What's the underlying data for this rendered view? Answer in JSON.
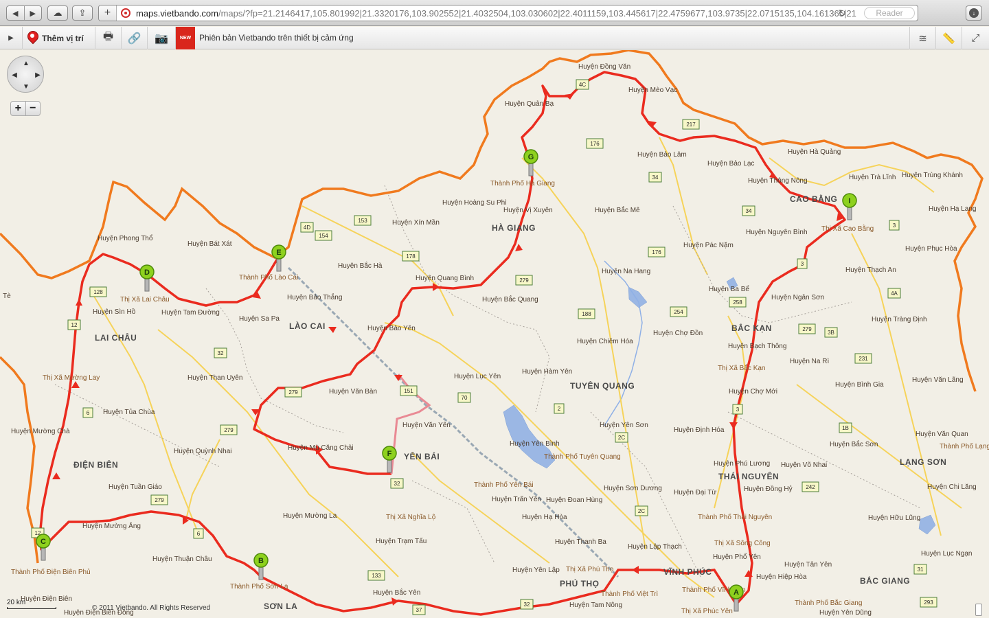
{
  "browser": {
    "url_host": "maps.vietbando.com",
    "url_path": "/maps/?fp=21.2146417,105.801992|21.3320176,103.902552|21.4032504,103.030602|22.4011159,103.445617|22.4759677,103.9735|22.0715135,104.161365|21",
    "reader_label": "Reader",
    "icons": {
      "back": "back-arrow-icon",
      "forward": "forward-arrow-icon",
      "cloud": "icloud-tabs-icon",
      "share": "share-icon",
      "add": "add-bookmark-icon",
      "reload": "reload-icon",
      "download": "download-icon"
    }
  },
  "toolbar": {
    "add_location_label": "Thêm vị trí",
    "new_badge": "NEW",
    "promo_text": "Phiên bản Vietbando trên thiết bị cảm ứng",
    "icons": [
      "print-icon",
      "link-icon",
      "camera-icon",
      "layers-icon",
      "ruler-icon",
      "fullscreen-icon"
    ]
  },
  "map": {
    "colors": {
      "land": "#f2efe6",
      "border": "#f07a1e",
      "route": "#ea2b1f",
      "route_light": "#e98a94",
      "highway": "#f6d35a",
      "water": "#9bb7e4",
      "marker": "#8ed11e"
    },
    "provinces": [
      "CAO BẰNG",
      "HÀ GIANG",
      "LÀO CAI",
      "BẮC KẠN",
      "LAI CHÂU",
      "TUYÊN QUANG",
      "YÊN BÁI",
      "LẠNG SƠN",
      "ĐIỆN BIÊN",
      "THÁI NGUYÊN",
      "VĨNH PHÚC",
      "PHÚ THỌ",
      "BẮC GIANG",
      "SƠN LA"
    ],
    "districts": [
      "Huyện Đồng Văn",
      "Huyện Mèo Vạc",
      "Huyện Quản Bạ",
      "Huyện Bảo Lâm",
      "Huyện Bảo Lạc",
      "Huyện Hà Quảng",
      "Huyện Trà Lĩnh",
      "Huyện Trùng Khánh",
      "Thành Phố Hà Giang",
      "Huyện Hoàng Su Phì",
      "Huyện Vị Xuyên",
      "Huyện Bắc Mê",
      "Huyện Thông Nông",
      "Huyện Hạ Lang",
      "Huyện Xín Mần",
      "Huyện Nguyên Bình",
      "Thị Xã Cao Bằng",
      "Huyện Phong Thổ",
      "Huyện Bát Xát",
      "Huyện Pác Nặm",
      "Huyện Phục Hòa",
      "Huyện Bắc Hà",
      "Thành Phố Lào Cai",
      "Huyện Na Hang",
      "Huyện Thạch An",
      "Thị Xã Lai Châu",
      "Huyện Quang Bình",
      "Huyện Bảo Thắng",
      "Huyện Bắc Quang",
      "Huyện Ba Bể",
      "Huyện Ngân Sơn",
      "Huyện Sìn Hồ",
      "Huyện Tam Đường",
      "Huyện Sa Pa",
      "Huyện Tràng Định",
      "Huyện Bảo Yên",
      "Huyện Chợ Đồn",
      "Huyện Chiêm Hóa",
      "Huyện Bạch Thông",
      "Huyện Na Rì",
      "Thị Xã Bắc Kạn",
      "Huyện Lục Yên",
      "Thị Xã Mường Lay",
      "Huyện Than Uyên",
      "Huyện Văn Bàn",
      "Huyện Hàm Yên",
      "Huyện Bình Gia",
      "Huyện Văn Lãng",
      "Huyện Chợ Mới",
      "Huyện Tủa Chùa",
      "Huyện Văn Yên",
      "Huyện Mường Chà",
      "Huyện Yên Sơn",
      "Huyện Văn Quan",
      "Huyện Định Hóa",
      "Huyện Quỳnh Nhai",
      "Huyện Mù Căng Chải",
      "Huyện Yên Bình",
      "Thành Phố Tuyên Quang",
      "Huyện Bắc Sơn",
      "Thành Phố Lạng Sơn",
      "Huyện Phú Lương",
      "Huyện Võ Nhai",
      "Huyện Tuần Giáo",
      "Thành Phố Yên Bái",
      "Huyện Sơn Dương",
      "Huyện Đại Từ",
      "Huyện Đồng Hỷ",
      "Huyện Chi Lăng",
      "Huyện Trấn Yên",
      "Huyện Đoan Hùng",
      "Huyện Hạ Hòa",
      "Thành Phố Thái Nguyên",
      "Huyện Hữu Lũng",
      "Huyện Mường Ảng",
      "Huyện Mường La",
      "Thị Xã Nghĩa Lộ",
      "Thị Xã Sông Công",
      "Huyện Thanh Ba",
      "Huyện Trạm Tấu",
      "Huyện Lập Thạch",
      "Huyện Phổ Yên",
      "Huyện Lục Ngạn",
      "Huyện Thuận Châu",
      "Thành Phố Điện Biên Phủ",
      "Huyện Yên Lập",
      "Thị Xã Phú Thọ",
      "Huyện Tân Yên",
      "Huyện Hiệp Hòa",
      "Thành Phố Việt Trì",
      "Thành Phố Vĩnh Yên",
      "Thành Phố Sơn La",
      "Huyện Tam Nông",
      "Thị Xã Phúc Yên",
      "Thành Phố Bắc Giang",
      "Huyện Bắc Yên",
      "Huyện Yên Dũng",
      "Huyện Điện Biên",
      "Huyện Điện Biên Đông",
      "Tè"
    ],
    "road_shields": [
      "4C",
      "217",
      "176",
      "34",
      "4D",
      "153",
      "154",
      "178",
      "34",
      "3",
      "128",
      "176",
      "279",
      "258",
      "3",
      "4A",
      "188",
      "12",
      "254",
      "279",
      "3B",
      "32",
      "231",
      "279",
      "151",
      "70",
      "6",
      "2",
      "279",
      "3",
      "1B",
      "2C",
      "32",
      "242",
      "279",
      "2C",
      "6",
      "12",
      "133",
      "31",
      "37",
      "32",
      "293"
    ],
    "route_markers": [
      "A",
      "B",
      "C",
      "D",
      "E",
      "F",
      "G",
      "I"
    ],
    "scale_label": "20 km",
    "copyright": "© 2011 Vietbando. All Rights Reserved",
    "controls": {
      "zoom_in": "+",
      "zoom_out": "−",
      "pan_up": "▲",
      "pan_down": "▼",
      "pan_left": "◀",
      "pan_right": "▶"
    }
  }
}
